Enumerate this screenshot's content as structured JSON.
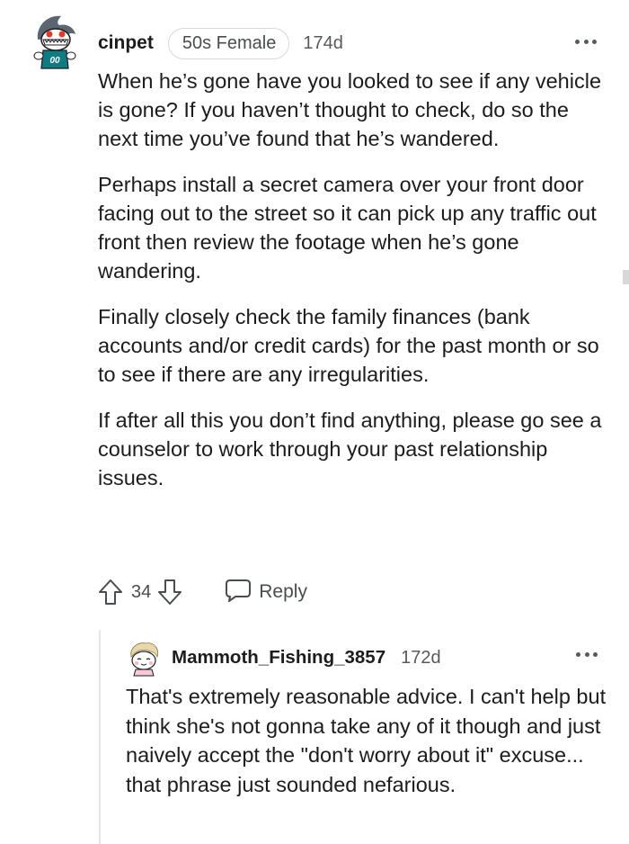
{
  "comment": {
    "username": "cinpet",
    "flair": "50s Female",
    "age": "174d",
    "avatar_icon": "shark-snoo-avatar-icon",
    "paragraphs": [
      "When he’s gone have you looked to see if any vehicle is gone? If you haven’t thought to check, do so the next time you’ve found that he’s wandered.",
      "Perhaps install a secret camera over your front door facing out to the street so it can pick up any traffic out front then review the footage when he’s gone wandering.",
      "Finally closely check the family finances (bank accounts and/or credit cards) for the past month or so to see if there are any irregularities.",
      "If after all this you don’t find anything, please go see a counselor to work through your past relationship issues."
    ],
    "score": "34",
    "reply_label": "Reply",
    "icons": {
      "more": "more-options-icon",
      "upvote": "upvote-arrow-icon",
      "downvote": "downvote-arrow-icon",
      "reply": "reply-bubble-icon"
    }
  },
  "reply": {
    "username": "Mammoth_Fishing_3857",
    "age": "172d",
    "avatar_icon": "snoo-avatar-icon",
    "text": "That's extremely reasonable advice. I can't help but think she's not gonna take any of it though and just naively accept the \"don't worry about it\" excuse... that phrase just sounded nefarious.",
    "icons": {
      "more": "more-options-icon"
    }
  },
  "colors": {
    "text": "#1c1c1c",
    "meta": "#575a5d",
    "flair_border": "#d5d9dc",
    "thread_line": "#e4e6e8"
  }
}
